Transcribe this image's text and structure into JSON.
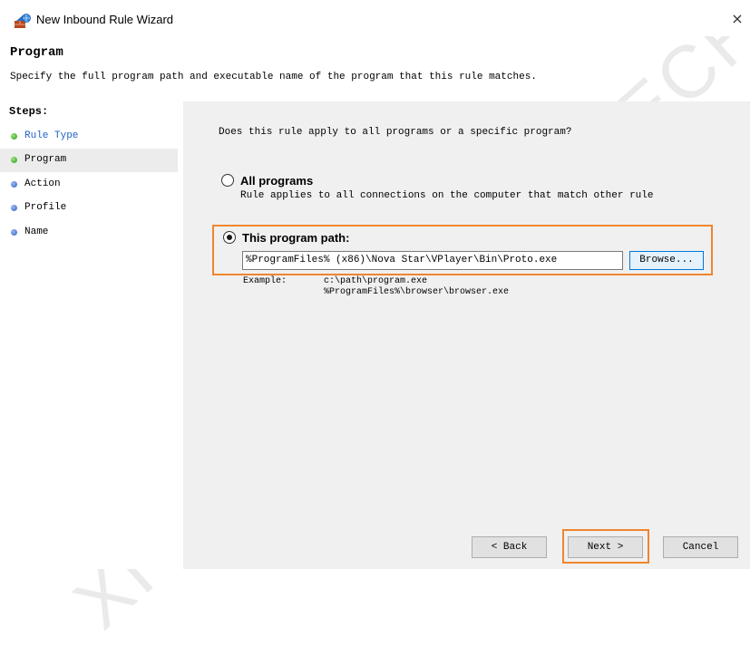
{
  "window": {
    "title": "New Inbound Rule Wizard",
    "close_glyph": "×"
  },
  "header": {
    "heading": "Program",
    "description": "Specify the full program path and executable name of the program that this rule matches."
  },
  "steps": {
    "title": "Steps:",
    "items": [
      {
        "label": "Rule Type",
        "state": "done"
      },
      {
        "label": "Program",
        "state": "current"
      },
      {
        "label": "Action",
        "state": "pending"
      },
      {
        "label": "Profile",
        "state": "pending"
      },
      {
        "label": "Name",
        "state": "pending"
      }
    ]
  },
  "main": {
    "question": "Does this rule apply to all programs or a specific program?",
    "options": {
      "all_programs": {
        "label": "All programs",
        "description": "Rule applies to all connections on the computer that match other rule",
        "selected": false
      },
      "program_path": {
        "label": "This program path:",
        "value": "%ProgramFiles% (x86)\\Nova Star\\VPlayer\\Bin\\Proto.exe",
        "selected": true
      }
    },
    "browse_label": "Browse...",
    "example": {
      "label": "Example:",
      "line1": "c:\\path\\program.exe",
      "line2": "%ProgramFiles%\\browser\\browser.exe"
    }
  },
  "footer": {
    "back_label": "< Back",
    "next_label": "Next >",
    "cancel_label": "Cancel"
  },
  "watermark": "XI'AN NOVASTAR TECH",
  "colors": {
    "highlight": "#f0852d",
    "link_blue": "#1e62c8",
    "panel_bg": "#f0f0f0"
  }
}
